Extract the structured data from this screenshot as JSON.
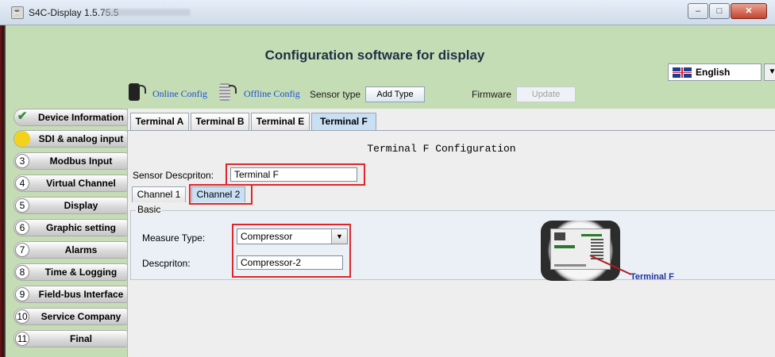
{
  "window": {
    "title": "S4C-Display 1.5.75.5",
    "controls": {
      "minimize": "‒",
      "maximize": "□",
      "close": "✕"
    }
  },
  "header": {
    "app_title": "Configuration software for display",
    "language": {
      "selected": "English",
      "flag_icon": "uk-flag-icon"
    },
    "online_config": "Online Config",
    "offline_config": "Offline Config",
    "sensor_type_label": "Sensor type",
    "add_type_button": "Add Type",
    "firmware_label": "Firmware",
    "update_button": "Update"
  },
  "sidebar": {
    "items": [
      {
        "marker": "✔",
        "label": "Device Information",
        "state": "done"
      },
      {
        "marker": "",
        "label": "SDI & analog input",
        "state": "active"
      },
      {
        "marker": "3",
        "label": "Modbus Input"
      },
      {
        "marker": "4",
        "label": "Virtual Channel"
      },
      {
        "marker": "5",
        "label": "Display"
      },
      {
        "marker": "6",
        "label": "Graphic setting"
      },
      {
        "marker": "7",
        "label": "Alarms"
      },
      {
        "marker": "8",
        "label": "Time & Logging"
      },
      {
        "marker": "9",
        "label": "Field-bus Interface"
      },
      {
        "marker": "10",
        "label": "Service Company"
      },
      {
        "marker": "11",
        "label": "Final"
      }
    ]
  },
  "main": {
    "tabs": [
      "Terminal A",
      "Terminal B",
      "Terminal E",
      "Terminal F"
    ],
    "active_tab": "Terminal F",
    "section_title": "Terminal F Configuration",
    "sensor_description_label": "Sensor Descpriton:",
    "sensor_description_value": "Terminal F",
    "channel_tabs": [
      "Channel 1",
      "Channel 2"
    ],
    "active_channel": "Channel 2",
    "basic_label": "Basic",
    "measure_type_label": "Measure Type:",
    "measure_type_value": "Compressor",
    "description_label": "Descpriton:",
    "description_value": "Compressor-2",
    "device_label": "Terminal F"
  },
  "colors": {
    "header_bg": "#c5ddb5",
    "highlight_red": "#e0262a",
    "active_tab": "#c9dff4",
    "link_blue": "#1a4fd0"
  }
}
